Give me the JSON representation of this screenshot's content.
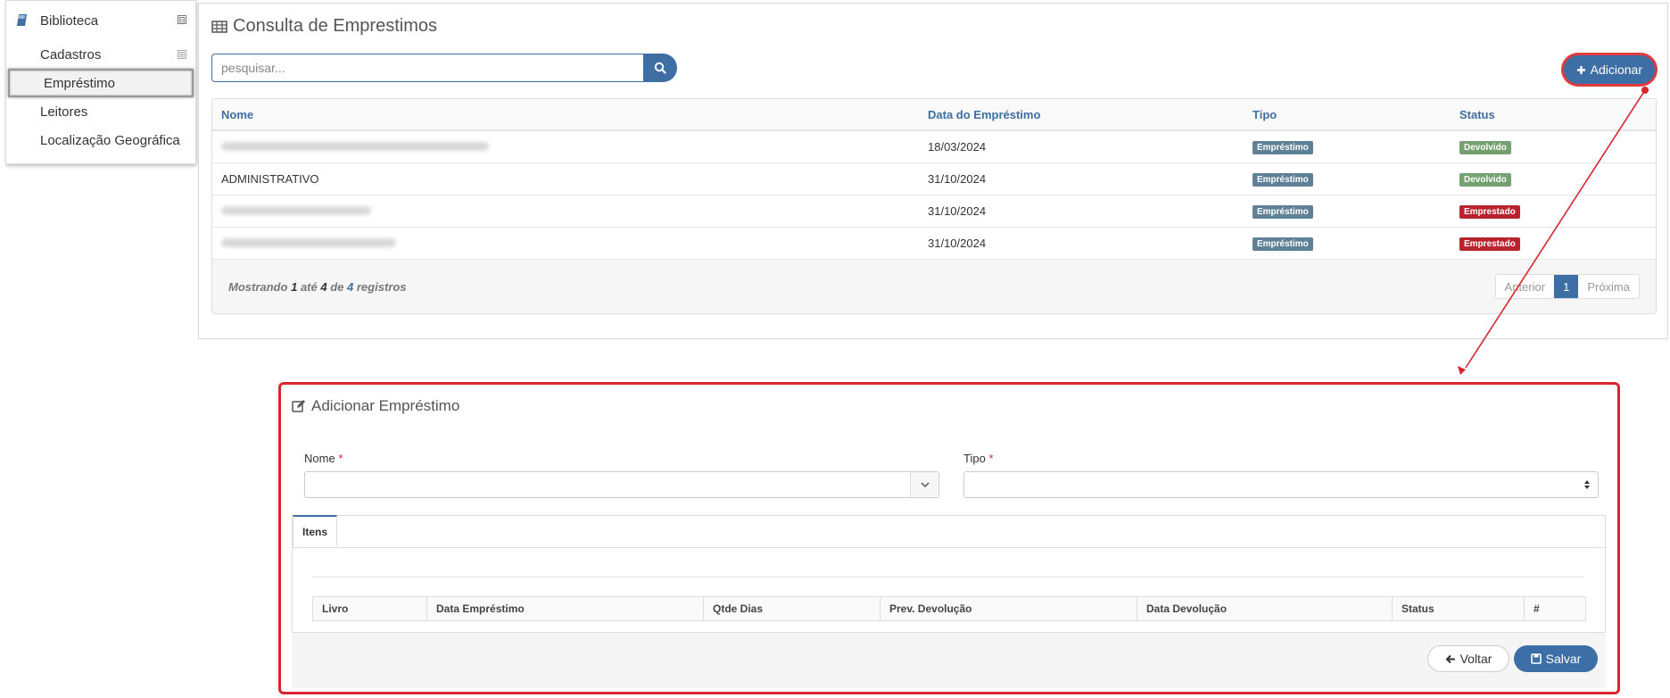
{
  "sidebar": {
    "title": "Biblioteca",
    "toggle_symbol": "⊟",
    "items": [
      {
        "label": "Cadastros",
        "expand_symbol": "⊞"
      },
      {
        "label": "Empréstimo"
      },
      {
        "label": "Leitores"
      },
      {
        "label": "Localização Geográfica"
      }
    ]
  },
  "main": {
    "title": "Consulta de Emprestimos",
    "search_placeholder": "pesquisar...",
    "add_button": "Adicionar",
    "columns": [
      "Nome",
      "Data do Empréstimo",
      "Tipo",
      "Status"
    ],
    "rows": [
      {
        "nome": "",
        "data": "18/03/2024",
        "tipo": "Empréstimo",
        "status": "Devolvido",
        "status_kind": "devolvido"
      },
      {
        "nome": "ADMINISTRATIVO",
        "data": "31/10/2024",
        "tipo": "Empréstimo",
        "status": "Devolvido",
        "status_kind": "devolvido"
      },
      {
        "nome": "",
        "data": "31/10/2024",
        "tipo": "Empréstimo",
        "status": "Emprestado",
        "status_kind": "emprestado"
      },
      {
        "nome": "",
        "data": "31/10/2024",
        "tipo": "Empréstimo",
        "status": "Emprestado",
        "status_kind": "emprestado"
      }
    ],
    "footer": {
      "mostrando": "Mostrando",
      "from": "1",
      "ate": "até",
      "to": "4",
      "de": "de",
      "total": "4",
      "registros": "registros"
    },
    "pager": {
      "prev": "Anterior",
      "current": "1",
      "next": "Próxima"
    }
  },
  "modal": {
    "title": "Adicionar Empréstimo",
    "nome_label": "Nome",
    "tipo_label": "Tipo",
    "required_mark": "*",
    "tab_label": "Itens",
    "item_columns": [
      "Livro",
      "Data Empréstimo",
      "Qtde Dias",
      "Prev. Devolução",
      "Data Devolução",
      "Status",
      "#"
    ],
    "voltar": "Voltar",
    "salvar": "Salvar"
  },
  "colors": {
    "primary": "#3d6fa6",
    "annotation": "#d9262e",
    "devolvido": "#73a270",
    "emprestado": "#b8232e",
    "tipo_badge": "#5f8197"
  }
}
